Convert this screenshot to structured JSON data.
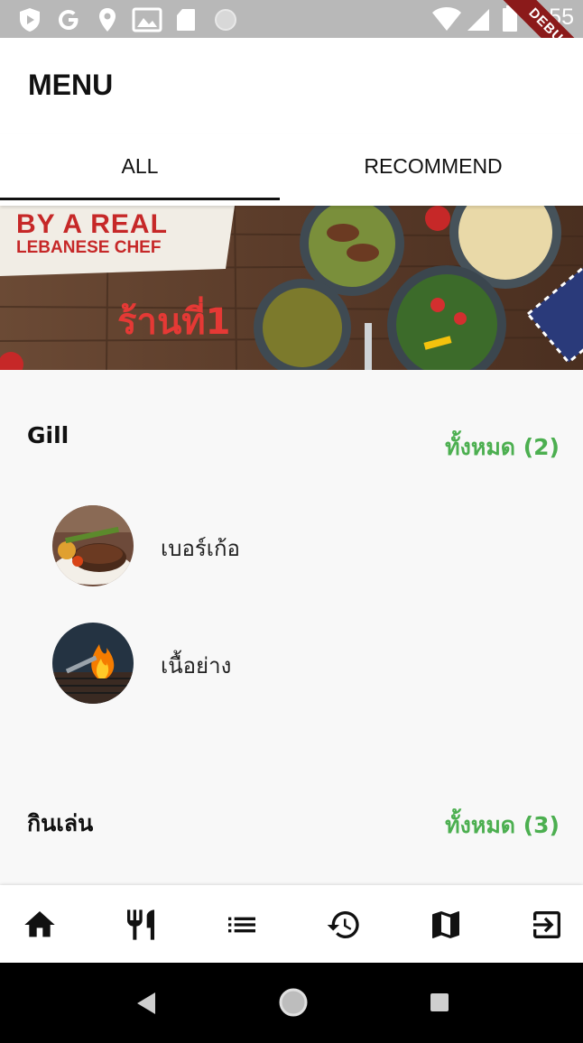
{
  "status_bar": {
    "time": "8:55",
    "debug_label": "DEBUG"
  },
  "app_bar": {
    "title": "MENU"
  },
  "tabs": [
    {
      "label": "ALL",
      "active": true
    },
    {
      "label": "RECOMMEND",
      "active": false
    }
  ],
  "banner": {
    "line1": "BY A REAL",
    "line2": "LEBANESE CHEF",
    "shop_name": "ร้านที่1"
  },
  "sections": [
    {
      "title": "Gill",
      "more_label": "ทั้งหมด (2)",
      "items": [
        {
          "name": "เบอร์เก้อ",
          "image": "steak-food-image"
        },
        {
          "name": "เนื้อย่าง",
          "image": "grill-flame-image"
        }
      ]
    },
    {
      "title": "กินเล่น",
      "more_label": "ทั้งหมด (3)",
      "items": []
    }
  ],
  "bottom_nav": [
    {
      "icon": "home-icon"
    },
    {
      "icon": "restaurant-icon"
    },
    {
      "icon": "list-icon"
    },
    {
      "icon": "history-icon"
    },
    {
      "icon": "map-icon"
    },
    {
      "icon": "logout-icon"
    }
  ],
  "system_nav": [
    {
      "icon": "back-icon"
    },
    {
      "icon": "home-circle-icon"
    },
    {
      "icon": "recents-icon"
    }
  ],
  "colors": {
    "accent_green": "#4caf50",
    "shop_red": "#e53935",
    "status_bar": "#b8b8b8"
  }
}
